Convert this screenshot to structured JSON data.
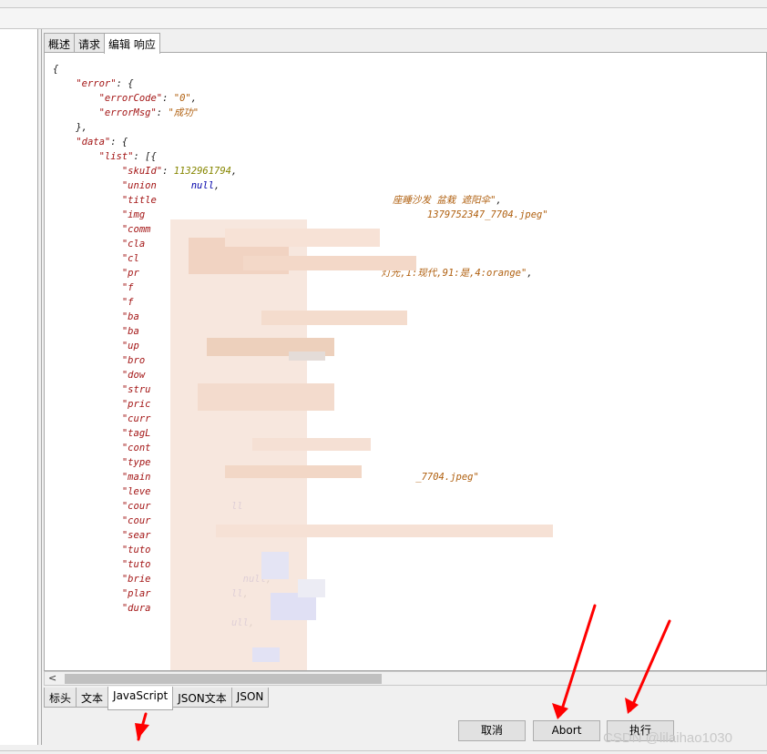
{
  "tabs": [
    "概述",
    "请求",
    "编辑 响应"
  ],
  "json_lines": [
    {
      "t": "{"
    },
    {
      "t": "    ",
      "k": "\"error\"",
      "r": ": {"
    },
    {
      "t": "        ",
      "k": "\"errorCode\"",
      "r": ": ",
      "s": "\"0\"",
      "e": ","
    },
    {
      "t": "        ",
      "k": "\"errorMsg\"",
      "r": ": ",
      "s": "\"成功\""
    },
    {
      "t": "    },"
    },
    {
      "t": "    ",
      "k": "\"data\"",
      "r": ": {"
    },
    {
      "t": "        ",
      "k": "\"list\"",
      "r": ": [{"
    },
    {
      "t": "            ",
      "k": "\"skuId\"",
      "r": ": ",
      "n": "1132961794",
      "e": ","
    },
    {
      "t": "            ",
      "k": "\"union",
      "r": "      ",
      "nl": "null",
      "e": ","
    },
    {
      "t": "            ",
      "k": "\"title",
      "r": "                                         ",
      "s": "座睡沙发 盆栽 遮阳伞\"",
      "e": ","
    },
    {
      "t": "            ",
      "k": "\"img",
      "r": "                                                 ",
      "s": "1379752347_7704.jpeg\""
    },
    {
      "t": "            ",
      "k": "\"comm"
    },
    {
      "t": "            ",
      "k": "\"cla"
    },
    {
      "t": "            ",
      "k": "\"cl",
      "r": "              ",
      "s": "\""
    },
    {
      "t": "            ",
      "k": "\"pr",
      "r": "                                          ",
      "s": "灯光,1:现代,91:是,4:orange\"",
      "e": ","
    },
    {
      "t": "            ",
      "k": "\"f"
    },
    {
      "t": "            ",
      "k": "\"f"
    },
    {
      "t": "            ",
      "k": "\"ba"
    },
    {
      "t": "            ",
      "k": "\"ba"
    },
    {
      "t": "            ",
      "k": "\"up"
    },
    {
      "t": "            ",
      "k": "\"bro"
    },
    {
      "t": "            ",
      "k": "\"dow"
    },
    {
      "t": "            ",
      "k": "\"stru"
    },
    {
      "t": "            ",
      "k": "\"pric"
    },
    {
      "t": "            ",
      "k": "\"curr"
    },
    {
      "t": "            ",
      "k": "\"tagL"
    },
    {
      "t": "            ",
      "k": "\"cont"
    },
    {
      "t": "            ",
      "k": "\"type"
    },
    {
      "t": "            ",
      "k": "\"main",
      "r": "                                              ",
      "s": "_7704.jpeg\""
    },
    {
      "t": "            ",
      "k": "\"leve"
    },
    {
      "t": "            ",
      "k": "\"cour",
      "r": "              ",
      "nl": "ll"
    },
    {
      "t": "            ",
      "k": "\"cour"
    },
    {
      "t": "            ",
      "k": "\"sear"
    },
    {
      "t": "            ",
      "k": "\"tuto"
    },
    {
      "t": "            ",
      "k": "\"tuto"
    },
    {
      "t": "            ",
      "k": "\"brie",
      "r": "                ",
      "nl": "null",
      "e": ","
    },
    {
      "t": "            ",
      "k": "\"plar",
      "r": "              ",
      "nl": "ll",
      "e": ","
    },
    {
      "t": "            ",
      "k": "\"dura"
    },
    {
      "t": "            ",
      "r": "                   ",
      "nl": "ull",
      "e": ","
    },
    {
      "t": ""
    },
    {
      "t": ""
    }
  ],
  "hscroll_arrow": "<",
  "bottom_tabs": [
    "标头",
    "文本",
    "JavaScript",
    "JSON文本",
    "JSON"
  ],
  "buttons": {
    "cancel": "取消",
    "abort": "Abort",
    "execute": "执行"
  },
  "watermark": "CSDN @lilaihao1030",
  "colors": {
    "key": "#a31515",
    "string": "#b06010",
    "number": "#868600",
    "null": "#0000aa",
    "arrow": "#ff0000"
  }
}
